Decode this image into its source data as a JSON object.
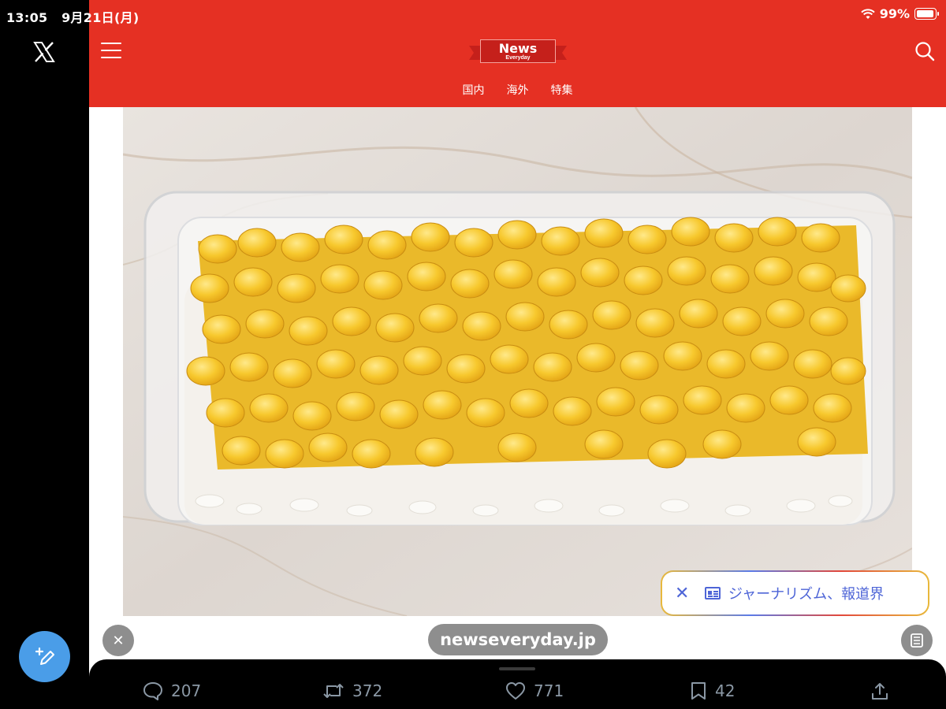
{
  "status": {
    "time": "13:05",
    "date": "9月21日(月)",
    "battery": "99%"
  },
  "sidebar": {
    "logo_icon": "x-logo-icon",
    "compose_icon": "compose-post-icon"
  },
  "site": {
    "logo_title": "News",
    "logo_sub": "Everyday",
    "nav": [
      "国内",
      "海外",
      "特集"
    ],
    "header_color": "#e53023"
  },
  "ai_pill": {
    "label": "ジャーナリズム、報道界"
  },
  "browser": {
    "url": "newseveryday.jp"
  },
  "actions": {
    "replies": "207",
    "reposts": "372",
    "likes": "771",
    "bookmarks": "42"
  }
}
